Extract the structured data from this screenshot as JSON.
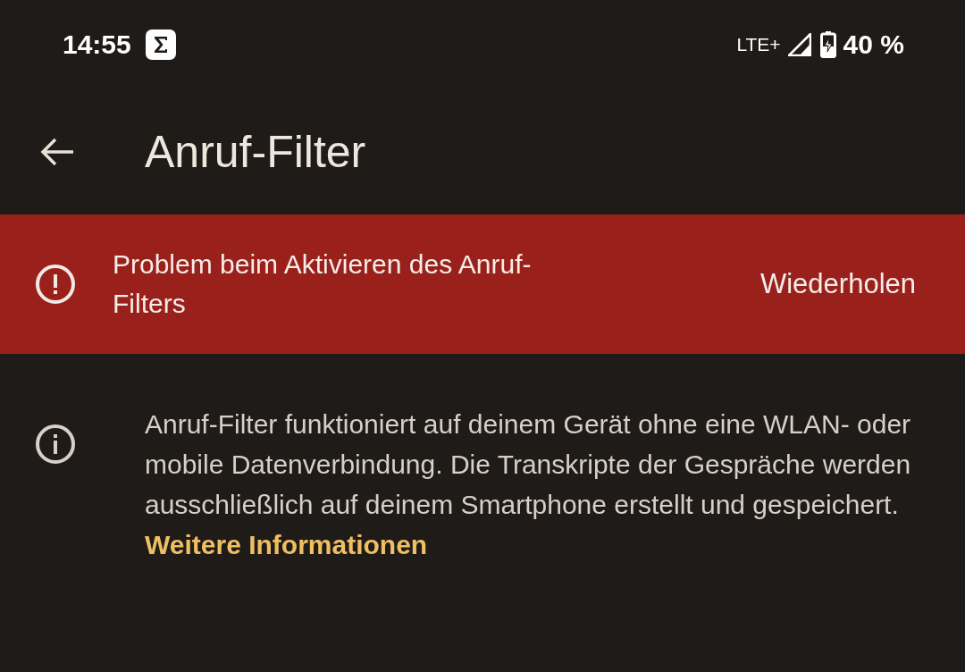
{
  "status_bar": {
    "time": "14:55",
    "network": "LTE+",
    "battery": "40 %"
  },
  "app_bar": {
    "title": "Anruf-Filter"
  },
  "error_banner": {
    "message": "Problem beim Aktivieren des Anruf-Filters",
    "action": "Wiederholen"
  },
  "info": {
    "text": "Anruf-Filter funktioniert auf deinem Gerät ohne eine WLAN- oder mobile Datenverbindung. Die Transkripte der Gespräche werden ausschließlich auf deinem Smartphone erstellt und gespeichert.",
    "link": "Weitere Informationen"
  }
}
